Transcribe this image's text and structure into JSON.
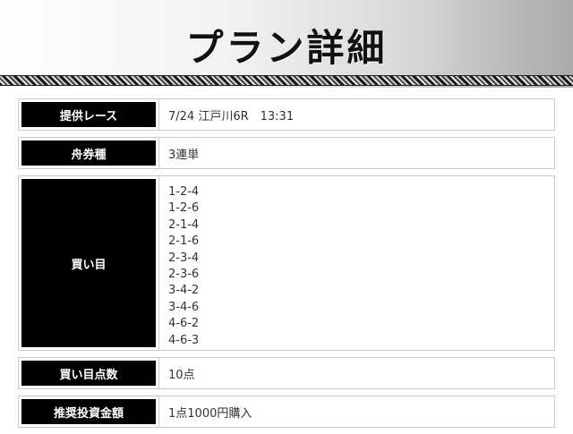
{
  "header": {
    "title": "プラン詳細"
  },
  "rows": {
    "race": {
      "label": "提供レース",
      "value": "7/24 江戸川6R　13:31"
    },
    "type": {
      "label": "舟券種",
      "value": "3連単"
    },
    "picks": {
      "label": "買い目",
      "items": [
        "1-2-4",
        "1-2-6",
        "2-1-4",
        "2-1-6",
        "2-3-4",
        "2-3-6",
        "3-4-2",
        "3-4-6",
        "4-6-2",
        "4-6-3"
      ]
    },
    "count": {
      "label": "買い目点数",
      "value": "10点"
    },
    "amount": {
      "label": "推奨投資金額",
      "value": "1点1000円購入"
    }
  }
}
